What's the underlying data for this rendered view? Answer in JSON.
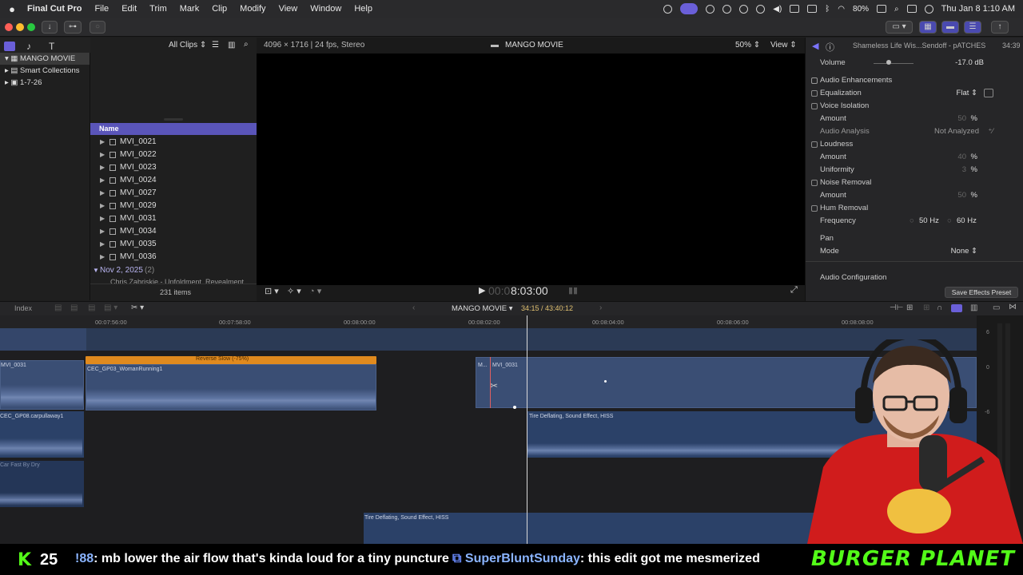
{
  "menubar": {
    "app_name": "Final Cut Pro",
    "menus": [
      "File",
      "Edit",
      "Trim",
      "Mark",
      "Clip",
      "Modify",
      "View",
      "Window",
      "Help"
    ],
    "battery": "80%",
    "datetime": "Thu Jan 8  1:10 AM"
  },
  "library": {
    "title": "MANGO MOVIE",
    "items": [
      "Smart Collections",
      "1-7-26"
    ]
  },
  "browser": {
    "filter": "All Clips",
    "column_name": "Name",
    "clips": [
      "MVI_0021",
      "MVI_0022",
      "MVI_0023",
      "MVI_0024",
      "MVI_0027",
      "MVI_0029",
      "MVI_0031",
      "MVI_0034",
      "MVI_0035",
      "MVI_0036"
    ],
    "group_label": "Nov 2, 2025",
    "group_count": "(2)",
    "group_child": "Chris Zabriskie - Unfoldment, Revealment",
    "item_count": "231 items"
  },
  "viewer": {
    "format": "4096 × 1716 | 24 fps, Stereo",
    "title": "MANGO MOVIE",
    "zoom": "50%",
    "view_label": "View",
    "timecode_dim": "00:0",
    "timecode": "8:03:00"
  },
  "inspector": {
    "clip_name": "Shameless Life Wis...Sendoff - pATCHES",
    "clip_duration": "34:39",
    "volume_label": "Volume",
    "volume_value": "-17.0 dB",
    "section_enh": "Audio Enhancements",
    "eq_label": "Equalization",
    "eq_value": "Flat",
    "voice_iso": "Voice Isolation",
    "amount_label": "Amount",
    "amount_vi": "50",
    "pct": "%",
    "analysis_label": "Audio Analysis",
    "analysis_value": "Not Analyzed",
    "loudness": "Loudness",
    "amount_loud": "40",
    "uniformity_label": "Uniformity",
    "uniformity_value": "3",
    "noise_removal": "Noise Removal",
    "amount_noise": "50",
    "hum_removal": "Hum Removal",
    "frequency_label": "Frequency",
    "freq_50": "50 Hz",
    "freq_60": "60 Hz",
    "pan_label": "Pan",
    "mode_label": "Mode",
    "mode_value": "None",
    "audio_config": "Audio Configuration",
    "save_preset": "Save Effects Preset"
  },
  "timeline": {
    "index_label": "Index",
    "project": "MANGO MOVIE",
    "duration": "34:15 / 43:40:12",
    "ruler": [
      "00:07:56:00",
      "00:07:58:00",
      "00:08:00:00",
      "00:08:02:00",
      "00:08:04:00",
      "00:08:06:00",
      "00:08:08:00"
    ],
    "clip_left": "MVI_0031",
    "retime_label": "Reverse Slow (-75%)",
    "clip_woman": "CEC_GP03_WomanRunning1",
    "clip_carpool": "CEC_GP08.carpullaway1",
    "clip_car": "Car Fast By Dry",
    "clip_mvi_m": "M...",
    "clip_mvi": "MVI_0031",
    "sfx_1": "Tire Deflating, Sound Effect, HISS",
    "sfx_2": "Tire Deflating, Sound Effect, HISS",
    "meter_ticks": [
      "6",
      "0",
      "-6"
    ]
  },
  "ticker": {
    "kick_badge": "K",
    "viewer_count": "25",
    "msg1_user": "!88",
    "msg1_text": ": mb lower the air flow that's kinda loud for a tiny puncture",
    "msg2_user": "SuperBluntSunday",
    "msg2_text": ": this edit got me mesmerized",
    "brand": "BURGER PLANET"
  },
  "colors": {
    "accent": "#5a55b9",
    "retime": "#e08a1e",
    "clip_blue": "#3a4e74",
    "kick_green": "#53fc18"
  }
}
